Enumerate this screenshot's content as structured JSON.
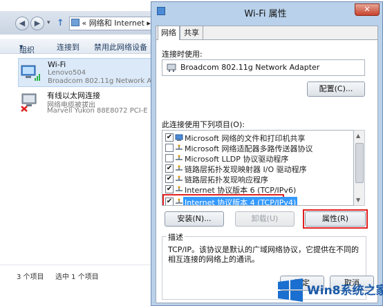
{
  "explorer": {
    "address_prefix": "«",
    "address": "网络和 Internet",
    "address_arrow": "▸",
    "toolbar": {
      "organize": "组织",
      "organize_arrow": "▼",
      "connect": "连接到",
      "disable": "禁用此网络设备"
    },
    "connections": [
      {
        "name": "Wi-Fi",
        "network": "Lenovo504",
        "adapter": "Broadcom 802.11g Network A..."
      },
      {
        "name": "有线以太网连接",
        "network": "网络电缆被拔出",
        "adapter": "Marvell Yukon 88E8072 PCI-E ..."
      }
    ],
    "status": {
      "count": "3 个项目",
      "selected": "选中 1 个项目"
    }
  },
  "dialog": {
    "title": "Wi-Fi 属性",
    "tabs": [
      "网络",
      "共享"
    ],
    "connect_using_label": "连接时使用:",
    "adapter": "Broadcom 802.11g Network Adapter",
    "configure": "配置(C)...",
    "items_label": "此连接使用下列项目(O):",
    "items": [
      {
        "checked": "✔",
        "label": "Microsoft 网络的文件和打印机共享"
      },
      {
        "checked": "",
        "label": "Microsoft 网络适配器多路传送器协议"
      },
      {
        "checked": "",
        "label": "Microsoft LLDP 协议驱动程序"
      },
      {
        "checked": "✔",
        "label": "链路层拓扑发现映射器 I/O 驱动程序"
      },
      {
        "checked": "✔",
        "label": "链路层拓扑发现响应程序"
      },
      {
        "checked": "✔",
        "label": "Internet 协议版本 6 (TCP/IPv6)"
      },
      {
        "checked": "✔",
        "label": "Internet 协议版本 4 (TCP/IPv4)"
      }
    ],
    "install": "安装(N)...",
    "uninstall": "卸载(U)",
    "properties": "属性(R)",
    "description_label": "描述",
    "description": "TCP/IP。该协议是默认的广域网络协议，它提供在不同的相互连接的网络上的通讯。",
    "ok": "确定",
    "cancel": "取消",
    "close_glyph": "✕"
  },
  "watermark": {
    "text": "Win8系统之家"
  },
  "colors": {
    "selection": "#3399ff",
    "highlight_border": "#e02020",
    "dialog_frame": "#b9d1ea"
  }
}
